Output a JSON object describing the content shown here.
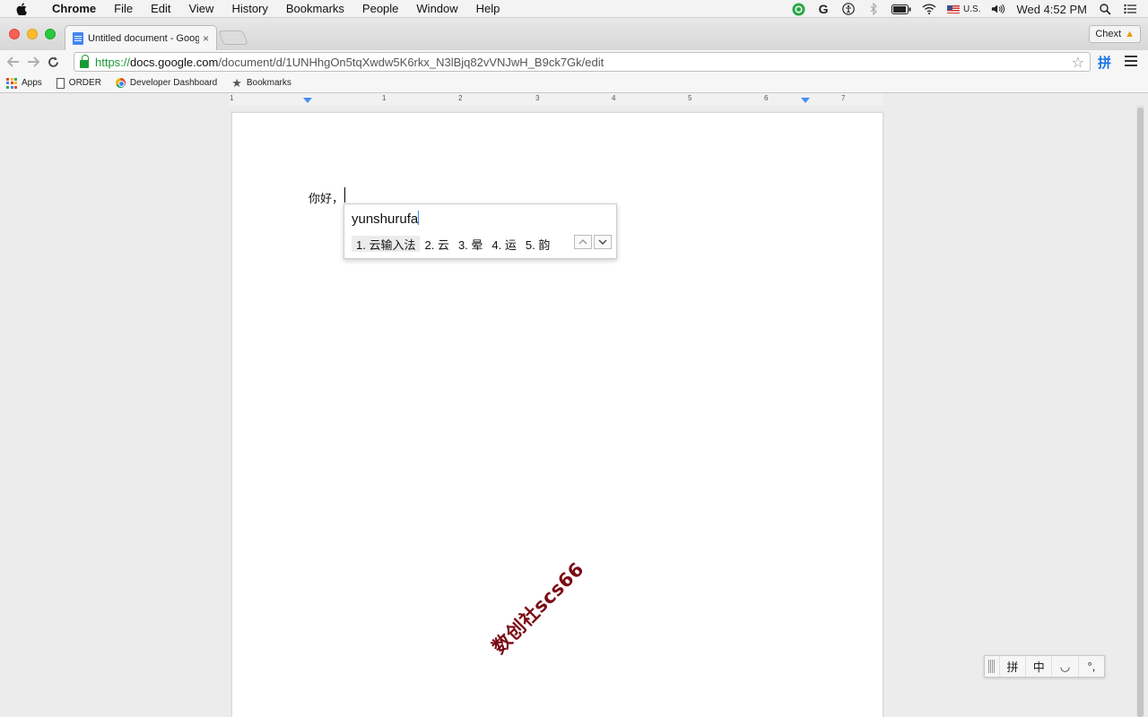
{
  "menubar": {
    "app_name": "Chrome",
    "items": [
      "File",
      "Edit",
      "View",
      "History",
      "Bookmarks",
      "People",
      "Window",
      "Help"
    ],
    "input_source": "U.S.",
    "clock": "Wed 4:52 PM",
    "grammarly_letter": "G"
  },
  "browser": {
    "tab_title": "Untitled document - Google Docs",
    "tab_close": "×",
    "extension_label": "Chext",
    "url_scheme": "https://",
    "url_host": "docs.google.com",
    "url_path": "/document/d/1UNHhgOn5tqXwdw5K6rkx_N3lBjq82vVNJwH_B9ck7Gk/edit",
    "ext_pin_label": "拼"
  },
  "bookmarks": [
    {
      "label": "Apps",
      "icon": "apps-grid-icon"
    },
    {
      "label": "ORDER",
      "icon": "file-icon"
    },
    {
      "label": "Developer Dashboard",
      "icon": "chrome-icon"
    },
    {
      "label": "Bookmarks",
      "icon": "star-icon"
    }
  ],
  "ruler": {
    "labels": [
      "1",
      "1",
      "2",
      "3",
      "4",
      "5",
      "6",
      "7"
    ]
  },
  "document": {
    "text": "你好，"
  },
  "ime": {
    "input": "yunshurufa",
    "candidates": [
      {
        "label": "1. 云输入法",
        "selected": true
      },
      {
        "label": "2. 云",
        "selected": false
      },
      {
        "label": "3. 晕",
        "selected": false
      },
      {
        "label": "4. 运",
        "selected": false
      },
      {
        "label": "5. 韵",
        "selected": false
      }
    ],
    "toolbar": [
      "拼",
      "中",
      "◡",
      "°,"
    ]
  },
  "watermark": "数创社scs66",
  "colors": {
    "accent": "#4285f4",
    "secure_green": "#1a9a35",
    "watermark": "#7a0a14"
  }
}
